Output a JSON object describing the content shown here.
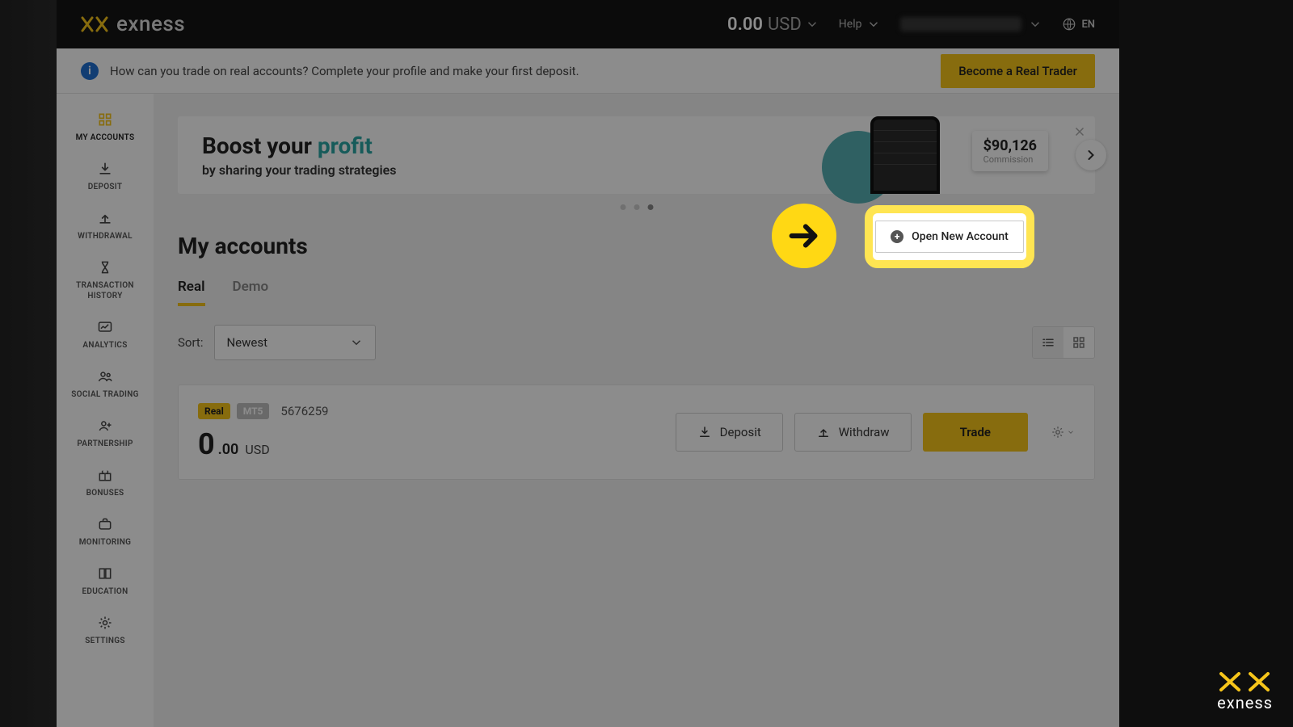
{
  "brand": {
    "name": "exness"
  },
  "header": {
    "balance_value": "0.00",
    "balance_currency": "USD",
    "help_label": "Help",
    "lang_label": "EN"
  },
  "notice": {
    "text": "How can you trade on real accounts? Complete your profile and make your first deposit.",
    "cta": "Become a Real Trader"
  },
  "sidebar": {
    "items": [
      {
        "label": "MY ACCOUNTS"
      },
      {
        "label": "DEPOSIT"
      },
      {
        "label": "WITHDRAWAL"
      },
      {
        "label": "TRANSACTION HISTORY"
      },
      {
        "label": "ANALYTICS"
      },
      {
        "label": "SOCIAL TRADING"
      },
      {
        "label": "PARTNERSHIP"
      },
      {
        "label": "BONUSES"
      },
      {
        "label": "MONITORING"
      },
      {
        "label": "EDUCATION"
      },
      {
        "label": "SETTINGS"
      }
    ]
  },
  "banner": {
    "title_pre": "Boost your ",
    "title_accent": "profit",
    "subtitle": "by sharing your trading strategies",
    "card_value": "$90,126",
    "card_sub": "Commission"
  },
  "section": {
    "title": "My accounts",
    "open_new": "Open New Account"
  },
  "tabs": {
    "real": "Real",
    "demo": "Demo"
  },
  "sort": {
    "label": "Sort:",
    "value": "Newest"
  },
  "account": {
    "tag_real": "Real",
    "tag_platform": "MT5",
    "number": "5676259",
    "balance_int": "0",
    "balance_dec": ".00",
    "balance_currency": "USD",
    "deposit": "Deposit",
    "withdraw": "Withdraw",
    "trade": "Trade"
  },
  "watermark": {
    "word": "exness"
  }
}
